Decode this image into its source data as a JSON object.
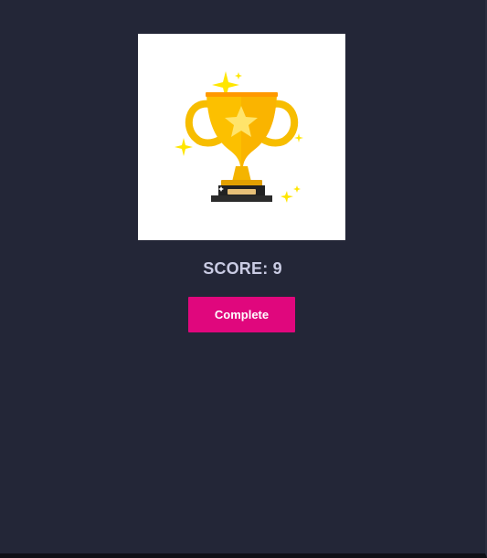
{
  "result": {
    "score_label": "SCORE: 9",
    "score_value": 9
  },
  "actions": {
    "complete_label": "Complete"
  },
  "trophy": {
    "icon": "trophy-icon"
  },
  "colors": {
    "background": "#232637",
    "card": "#ffffff",
    "score_text": "#c9cbe3",
    "button": "#e0077d",
    "trophy_gold": "#f7bd00",
    "sparkle": "#ffe600"
  }
}
